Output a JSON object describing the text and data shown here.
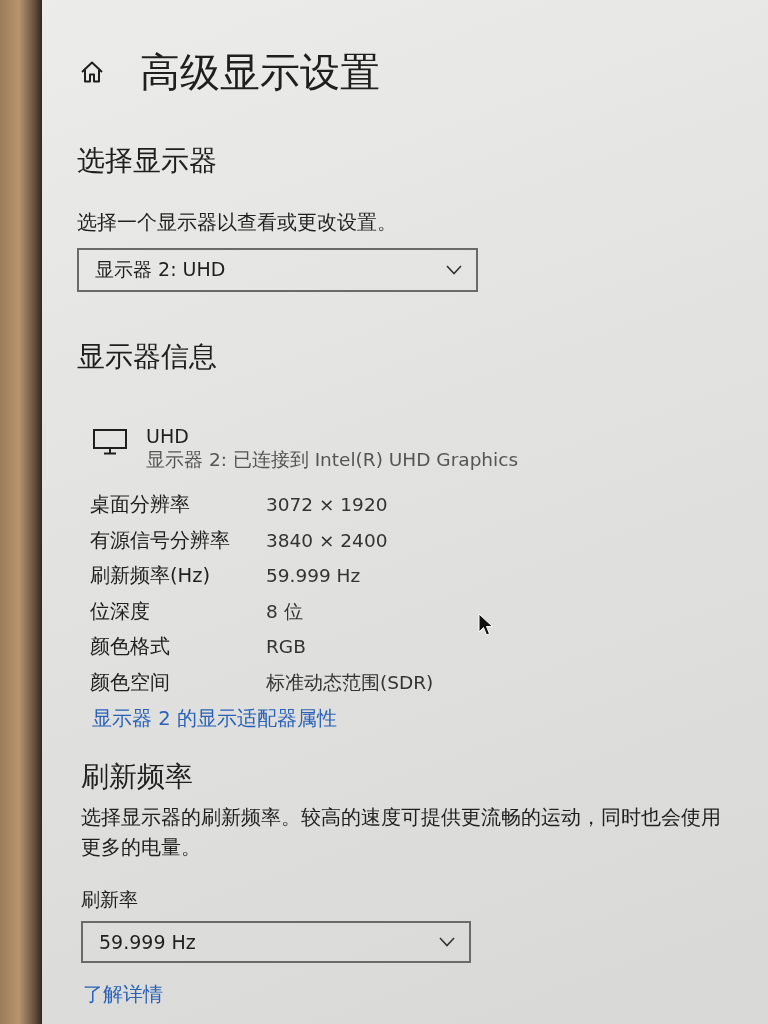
{
  "page": {
    "title": "高级显示设置"
  },
  "select_display": {
    "heading": "选择显示器",
    "description": "选择一个显示器以查看或更改设置。",
    "dropdown": {
      "value": "显示器 2: UHD"
    }
  },
  "display_info": {
    "heading": "显示器信息",
    "monitor": {
      "name": "UHD",
      "subtitle": "显示器 2: 已连接到 Intel(R) UHD Graphics"
    },
    "rows": [
      {
        "label": "桌面分辨率",
        "value": "3072 × 1920"
      },
      {
        "label": "有源信号分辨率",
        "value": "3840 × 2400"
      },
      {
        "label": "刷新频率(Hz)",
        "value": "59.999 Hz"
      },
      {
        "label": "位深度",
        "value": "8 位"
      },
      {
        "label": "颜色格式",
        "value": "RGB"
      },
      {
        "label": "颜色空间",
        "value": "标准动态范围(SDR)"
      }
    ],
    "link": "显示器 2 的显示适配器属性"
  },
  "refresh_rate": {
    "heading": "刷新频率",
    "description": "选择显示器的刷新频率。较高的速度可提供更流畅的运动，同时也会使用更多的电量。",
    "field_label": "刷新率",
    "dropdown": {
      "value": "59.999 Hz"
    },
    "link": "了解详情"
  }
}
